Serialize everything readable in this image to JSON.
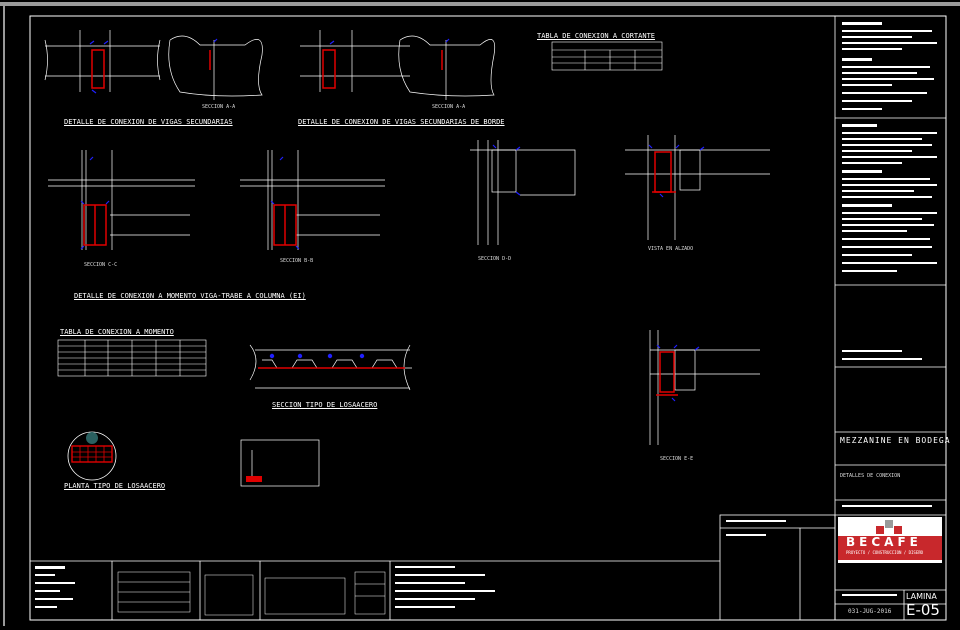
{
  "colors": {
    "background": "#000000",
    "line": "#ffffff",
    "accent_red": "#e00000",
    "accent_blue": "#2020ff",
    "grey": "#9a9a9a",
    "logo_red": "#c8282c"
  },
  "titles": {
    "detalle_vigas_sec": "DETALLE DE CONEXION DE VIGAS SECUNDARIAS",
    "detalle_vigas_borde": "DETALLE DE CONEXION DE VIGAS SECUNDARIAS DE BORDE",
    "detalle_momento": "DETALLE DE CONEXION A MOMENTO VIGA-TRABE A COLUMNA (EI)",
    "tabla_cortante": "TABLA DE CONEXION A CORTANTE",
    "tabla_momento": "TABLA DE CONEXION A MOMENTO",
    "seccion_losa": "SECCION TIPO DE LOSAACERO",
    "planta_losa": "PLANTA TIPO DE LOSAACERO"
  },
  "section_labels": {
    "aa": "SECCION A-A",
    "bb": "SECCION B-B",
    "cc": "SECCION C-C",
    "dd": "SECCION D-D",
    "ee": "SECCION E-E",
    "vista": "VISTA EN ALZADO"
  },
  "title_block": {
    "project": "MEZZANINE EN BODEGA",
    "drawing": "DETALLES DE CONEXION",
    "company": "BECAFE",
    "company_tagline": "PROYECTO / CONSTRUCCION / DISEÑO",
    "date": "031-JUG-2016",
    "sheet_label": "LAMINA",
    "sheet_number": "E-05"
  },
  "icons": [
    "becafe-logo-icon"
  ]
}
